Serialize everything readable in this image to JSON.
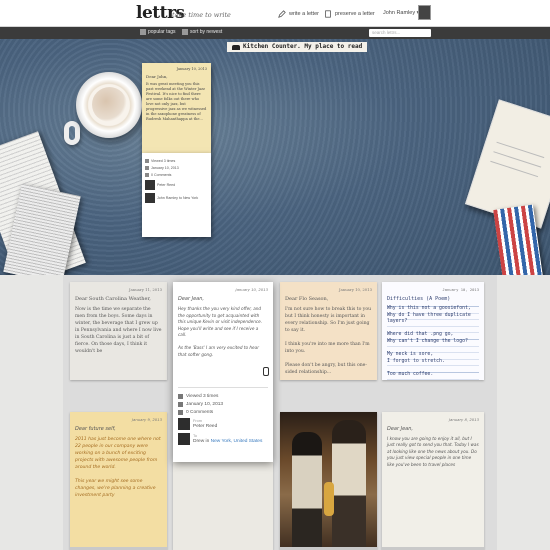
{
  "header": {
    "logo": "lettrs",
    "tagline": "take time to write",
    "write_label": "write a letter",
    "preserve_label": "preserve a letter",
    "user_name": "John Ramley ▾"
  },
  "nav": {
    "popular_tags": "popular tags",
    "sort_by": "sort by newest",
    "search_placeholder": "search lettrs..."
  },
  "desk": {
    "title": "Kitchen Counter. My place to read",
    "letter": {
      "date": "January 10, 2013",
      "salutation": "Dear John,",
      "body": "It was great meeting you this past weekend at the Winter Jazz Festival. It's nice to find there are some folks out there who love not only jazz, but progressive jazz as we witnessed in the saxophone greatness of Rudresh Mahanthappa at the...",
      "views": "Viewed 3 times",
      "sent_date": "January 10, 2013",
      "comments": "0 Comments",
      "from": "Peter Reed",
      "to": "John Ramley to New York"
    }
  },
  "cards": [
    {
      "date": "January 11, 2013",
      "greeting": "Dear South Carolina Weather,",
      "body": "Now is the time we separate the men from the boys. Some days in winter, the beverage that I grew up in Pennsylvania and where I now live in South Carolina is just a bit of fierce. On those days, I think it wouldn't be"
    },
    {
      "date": "January 10, 2013",
      "greeting": "Dear Jean,",
      "body": "Hey thanks the you very kind offer, and the opportunity to get acquainted with this unique Kevin or visit independence. Hope you'll write and see if I receive a call.\n\nAs the 'Bass' I am very excited to hear that softer gong.",
      "views": "Viewed 3 times",
      "sent_date": "January 10, 2013",
      "comments": "0 Comments",
      "from_label": "From",
      "from": "Peter Reed",
      "to_label": "To",
      "to": "Drew in",
      "location": "New York, United States"
    },
    {
      "date": "January 10, 2013",
      "greeting": "Dear Flo Season,",
      "body": "I'm not sure how to break this to you but I think honesty is important in every relationship. So I'm just going to say it.\n\nI think you're into me more than I'm into you.\n\nPlease don't be angry, but this one-sided relationship..."
    },
    {
      "date": "January 10, 2013",
      "greeting": "Difficulties (A Poem)",
      "body": "Why is this not a goosiefont,\nWhy do I have three duplicate layers?\n\nWhere did that .png go,\nWhy can't I change the logo?\n\nMy neck is sore,\nI forgot to stretch.\n\nToo much coffee.\n\n..."
    },
    {
      "date": "January 9, 2013",
      "greeting": "Dear future self,",
      "body": "2011 has just become one where not 22 people in our company were working on a bunch of exciting projects with awesome people from around the world.\n\nThis year we might see some changes, we're planning a creative investment party"
    },
    {
      "date": "",
      "greeting": "",
      "body": ""
    },
    {
      "date": "January 8, 2013",
      "greeting": "Dear Jean,",
      "body": "I know you are going to enjoy it all, but I just really got to send you that. Today I was at looking like one the news about you. Do you just view special people in one time like you've been to travel places"
    }
  ]
}
